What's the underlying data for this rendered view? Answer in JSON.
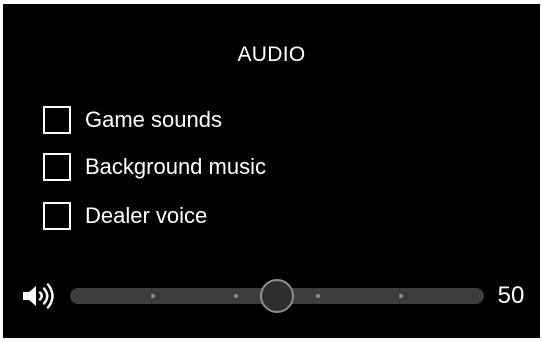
{
  "audio": {
    "title": "AUDIO",
    "options": [
      {
        "label": "Game sounds",
        "checked": false
      },
      {
        "label": "Background music",
        "checked": false
      },
      {
        "label": "Dealer voice",
        "checked": false
      }
    ],
    "volume": {
      "icon": "speaker-volume-icon",
      "value": 50,
      "value_label": "50",
      "min": 0,
      "max": 100,
      "tick_count": 4
    }
  },
  "colors": {
    "background": "#000000",
    "text": "#ffffff",
    "track": "#3d3d3d",
    "thumb": "#2e2e2e",
    "thumb_border": "#8e8e8e"
  }
}
